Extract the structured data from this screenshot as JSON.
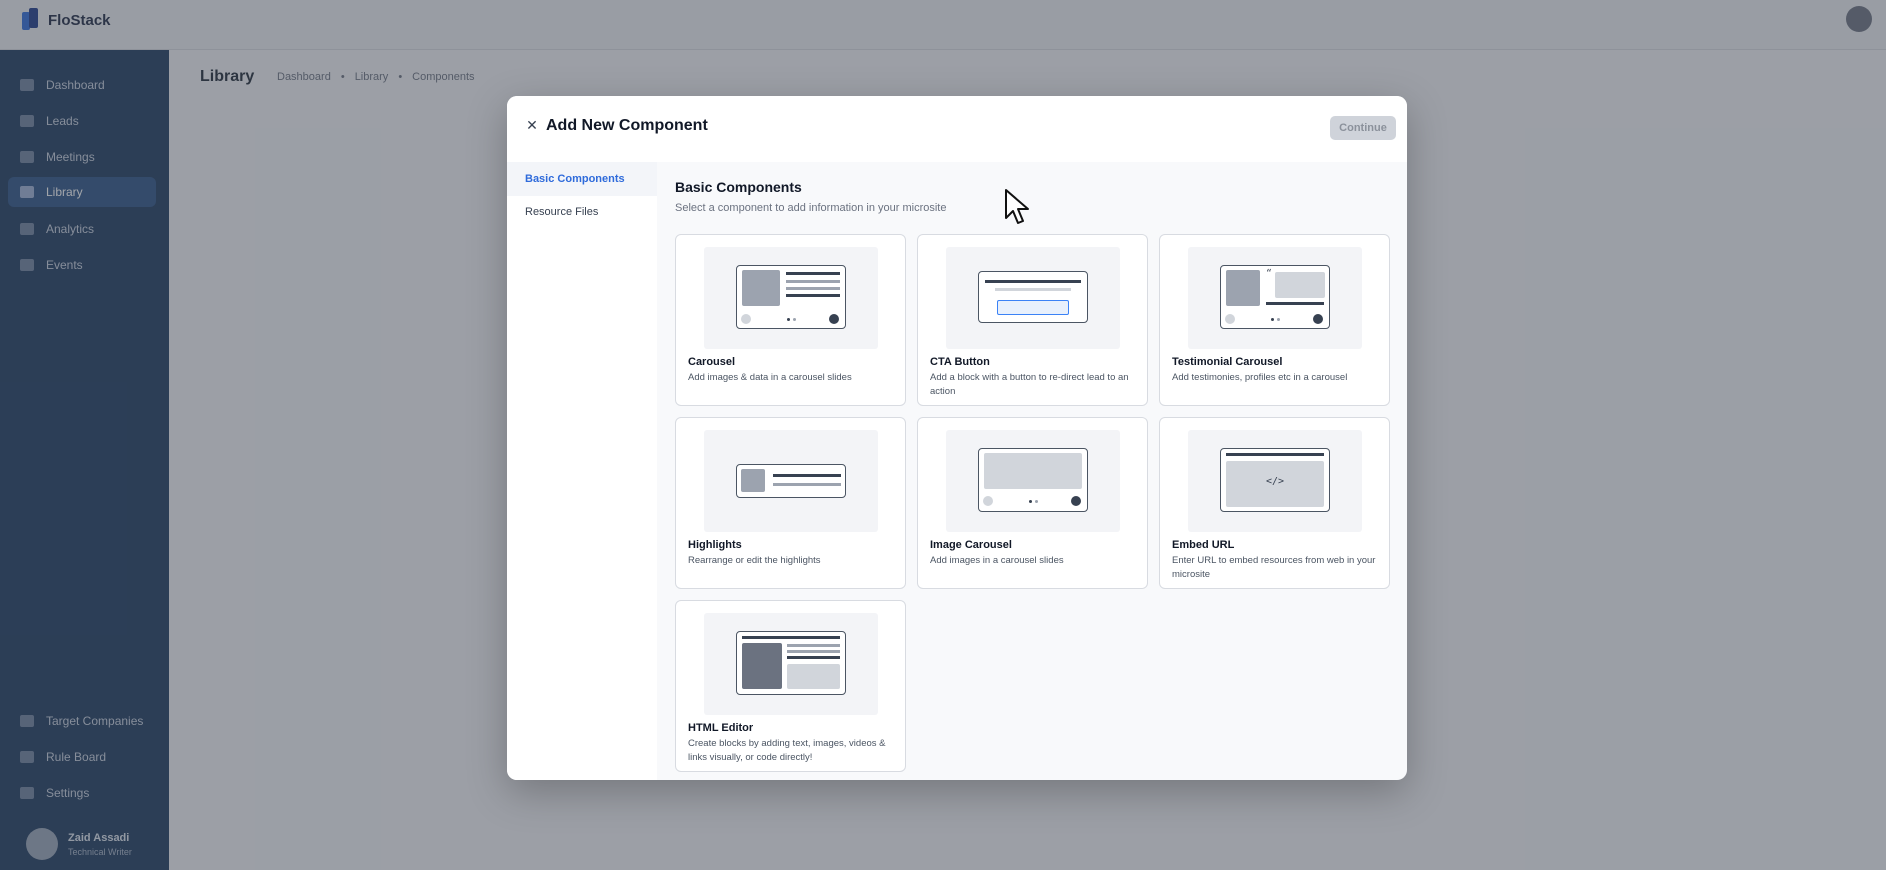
{
  "app": {
    "name": "FloStack"
  },
  "sidebar": {
    "items": [
      {
        "label": "Dashboard",
        "icon": "dashboard-icon"
      },
      {
        "label": "Leads",
        "icon": "leads-icon"
      },
      {
        "label": "Meetings",
        "icon": "calendar-icon"
      },
      {
        "label": "Library",
        "icon": "library-icon",
        "active": true
      },
      {
        "label": "Analytics",
        "icon": "analytics-icon"
      },
      {
        "label": "Events",
        "icon": "events-icon"
      }
    ],
    "bottom_items": [
      {
        "label": "Target Companies",
        "icon": "building-icon"
      },
      {
        "label": "Rule Board",
        "icon": "rule-board-icon"
      },
      {
        "label": "Settings",
        "icon": "gear-icon"
      }
    ],
    "user": {
      "name": "Zaid Assadi",
      "role": "Technical Writer"
    }
  },
  "page": {
    "title": "Library",
    "breadcrumb": [
      "Dashboard",
      "Library",
      "Components"
    ]
  },
  "modal": {
    "title": "Add New Component",
    "close_icon": "close-icon",
    "continue_label": "Continue",
    "nav": [
      {
        "label": "Basic Components",
        "active": true
      },
      {
        "label": "Resource Files",
        "active": false
      }
    ],
    "section_title": "Basic Components",
    "section_subtitle": "Select a component to add information in your microsite",
    "components": [
      {
        "title": "Carousel",
        "description": "Add images & data in a carousel slides"
      },
      {
        "title": "CTA Button",
        "description": "Add a block with a button to re-direct lead to an action"
      },
      {
        "title": "Testimonial Carousel",
        "description": "Add testimonies, profiles etc in a carousel"
      },
      {
        "title": "Highlights",
        "description": "Rearrange or edit the highlights"
      },
      {
        "title": "Image Carousel",
        "description": "Add images in a carousel slides"
      },
      {
        "title": "Embed URL",
        "description": "Enter URL to embed resources from web in your microsite"
      },
      {
        "title": "HTML Editor",
        "description": "Create blocks by adding text, images, videos & links visually, or code directly!"
      }
    ],
    "embed_code_glyph": "</>"
  },
  "colors": {
    "accent": "#2f6bdb",
    "sidebar_bg": "#1e3a5f",
    "sidebar_active": "#2d5487",
    "continue_disabled": "#cfd3da"
  }
}
